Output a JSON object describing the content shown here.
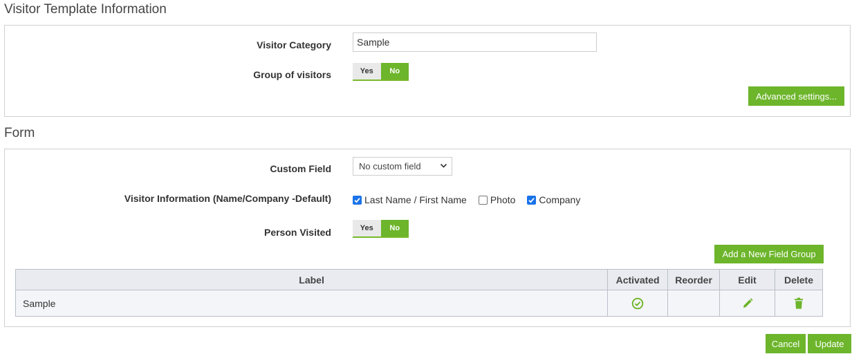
{
  "template_section": {
    "title": "Visitor Template Information",
    "visitor_category_label": "Visitor Category",
    "visitor_category_value": "Sample",
    "group_label": "Group of visitors",
    "yes_label": "Yes",
    "no_label": "No",
    "advanced_button": "Advanced settings..."
  },
  "form_section": {
    "title": "Form",
    "custom_field_label": "Custom Field",
    "custom_field_value": "No custom field",
    "visitor_info_label": "Visitor Information (Name/Company -Default)",
    "checkboxes": [
      {
        "label": "Last Name / First Name",
        "checked": true
      },
      {
        "label": "Photo",
        "checked": false
      },
      {
        "label": "Company",
        "checked": true
      }
    ],
    "person_visited_label": "Person Visited",
    "yes_label": "Yes",
    "no_label": "No",
    "add_group_button": "Add a New Field Group",
    "table": {
      "headers": [
        "Label",
        "Activated",
        "Reorder",
        "Edit",
        "Delete"
      ],
      "rows": [
        {
          "label": "Sample",
          "activated": true
        }
      ]
    }
  },
  "footer": {
    "cancel": "Cancel",
    "update": "Update"
  },
  "colors": {
    "accent": "#6db52b",
    "checkbox": "#1a73e8"
  }
}
